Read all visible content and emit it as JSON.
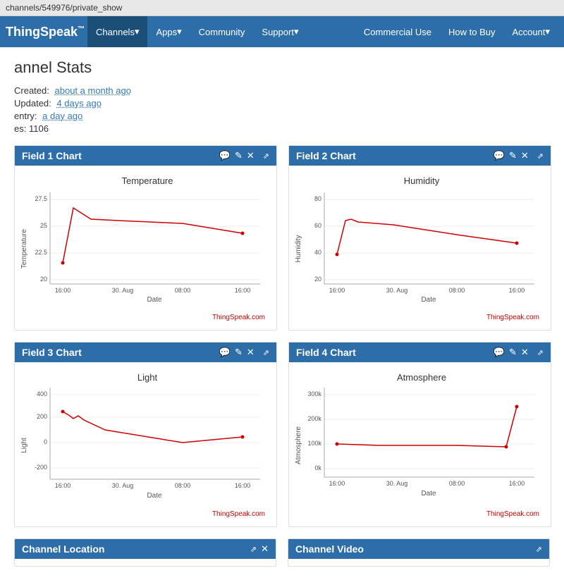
{
  "browser": {
    "url": "channels/549976/private_show"
  },
  "navbar": {
    "brand": "ThingSpeak",
    "brand_tm": "™",
    "items_left": [
      {
        "label": "Channels",
        "id": "channels",
        "active": true,
        "has_dropdown": true
      },
      {
        "label": "Apps",
        "id": "apps",
        "has_dropdown": true
      },
      {
        "label": "Community",
        "id": "community"
      },
      {
        "label": "Support",
        "id": "support",
        "has_dropdown": true
      }
    ],
    "items_right": [
      {
        "label": "Commercial Use",
        "id": "commercial"
      },
      {
        "label": "How to Buy",
        "id": "howtobuy"
      },
      {
        "label": "Account",
        "id": "account",
        "has_dropdown": true
      }
    ]
  },
  "page": {
    "title": "Channel Stats",
    "stats": {
      "created_label": "Created:",
      "created_value": "about a month ago",
      "updated_label": "Updated:",
      "updated_value": "4 days ago",
      "last_entry_label": "Last entry:",
      "last_entry_value": "a day ago",
      "entries_label": "Entries:",
      "entries_value": "1106"
    }
  },
  "charts": [
    {
      "id": "field1",
      "title": "Field 1 Chart",
      "chart_title": "Temperature",
      "x_label": "Date",
      "y_label": "Temperature",
      "x_ticks": [
        "16:00",
        "30. Aug",
        "08:00",
        "16:00"
      ],
      "y_ticks": [
        "27.5",
        "25",
        "22.5",
        "20"
      ],
      "thingspeak_label": "ThingSpeak.com",
      "color": "#c00"
    },
    {
      "id": "field2",
      "title": "Field 2 Chart",
      "chart_title": "Humidity",
      "x_label": "Date",
      "y_label": "Humidity",
      "x_ticks": [
        "16:00",
        "30. Aug",
        "08:00",
        "16:00"
      ],
      "y_ticks": [
        "80",
        "60",
        "40",
        "20"
      ],
      "thingspeak_label": "ThingSpeak.com",
      "color": "#c00"
    },
    {
      "id": "field3",
      "title": "Field 3 Chart",
      "chart_title": "Light",
      "x_label": "Date",
      "y_label": "Light",
      "x_ticks": [
        "16:00",
        "30. Aug",
        "08:00",
        "16:00"
      ],
      "y_ticks": [
        "400",
        "200",
        "0",
        "-200"
      ],
      "thingspeak_label": "ThingSpeak.com",
      "color": "#c00"
    },
    {
      "id": "field4",
      "title": "Field 4 Chart",
      "chart_title": "Atmosphere",
      "x_label": "Date",
      "y_label": "Atmosphere",
      "x_ticks": [
        "16:00",
        "30. Aug",
        "08:00",
        "16:00"
      ],
      "y_ticks": [
        "300k",
        "200k",
        "100k",
        "0k"
      ],
      "thingspeak_label": "ThingSpeak.com",
      "color": "#c00"
    }
  ],
  "bottom_cards": [
    {
      "title": "Channel Location"
    },
    {
      "title": "Channel Video"
    }
  ],
  "icons": {
    "comment": "💬",
    "edit": "✏",
    "close": "✕",
    "expand": "⤢",
    "dropdown": "▾"
  }
}
